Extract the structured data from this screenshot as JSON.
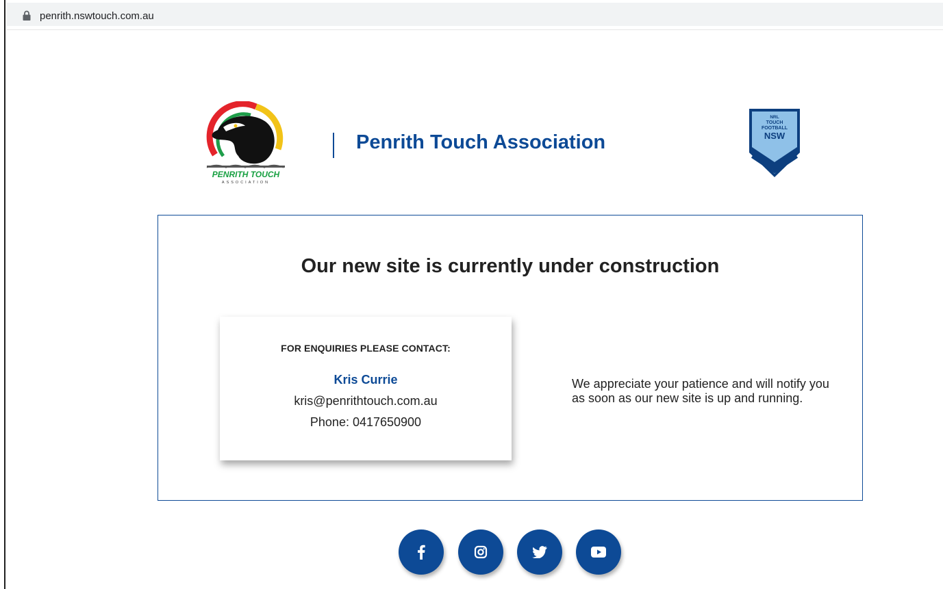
{
  "browser": {
    "url": "penrith.nswtouch.com.au",
    "lock_icon": "lock-icon"
  },
  "header": {
    "title": "Penrith Touch Association",
    "left_logo": {
      "icon": "penrith-touch-panther-logo",
      "text": "PENRITH TOUCH",
      "subtext": "ASSOCIATION"
    },
    "right_logo": {
      "icon": "nrl-touch-football-nsw-shield",
      "line1": "NRL",
      "line2": "TOUCH",
      "line3": "FOOTBALL",
      "line4": "NSW"
    }
  },
  "panel": {
    "heading": "Our new site is currently under construction",
    "contact": {
      "heading": "FOR ENQUIRIES PLEASE CONTACT:",
      "name": "Kris Currie",
      "email": "kris@penrithtouch.com.au",
      "phone": "Phone: 0417650900"
    },
    "message": "We appreciate your patience and will notify you as soon as our new site is up and running."
  },
  "social": [
    {
      "icon": "facebook-icon"
    },
    {
      "icon": "instagram-icon"
    },
    {
      "icon": "twitter-icon"
    },
    {
      "icon": "youtube-icon"
    }
  ],
  "colors": {
    "brand_blue": "#0d4a96",
    "text": "#222222",
    "url_bar": "#f1f3f4"
  }
}
